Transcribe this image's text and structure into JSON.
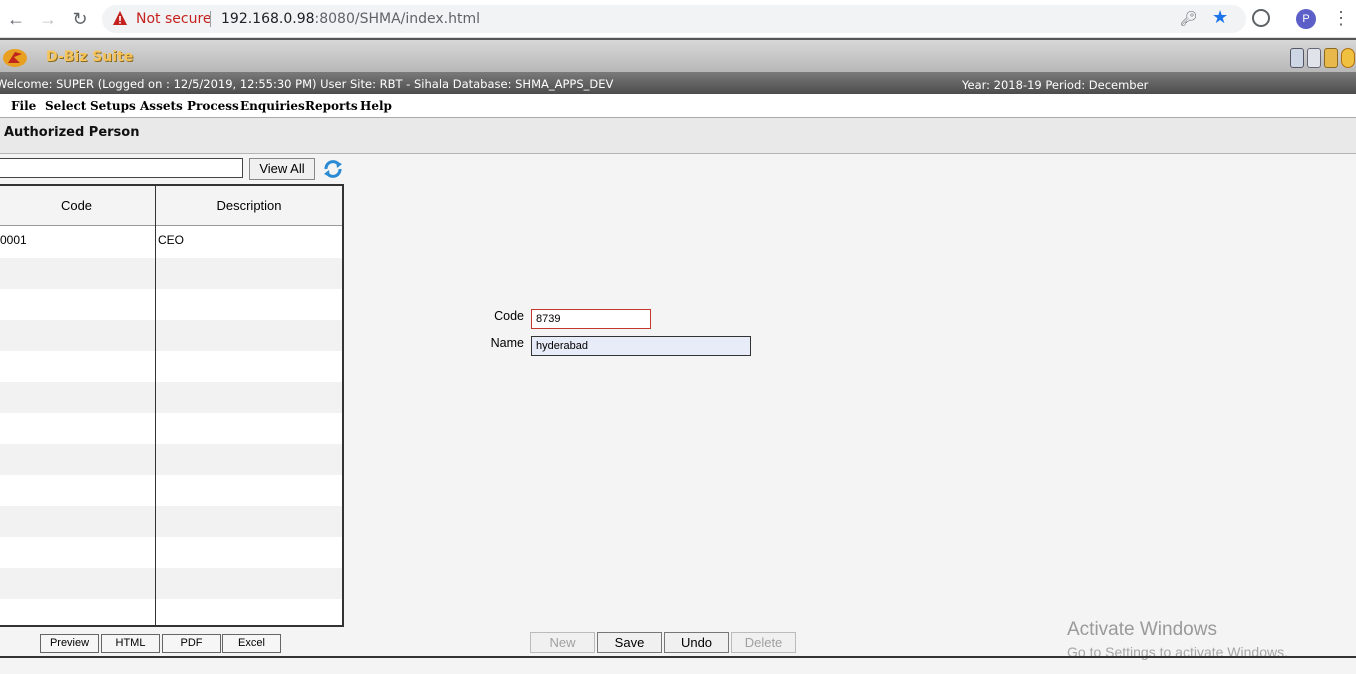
{
  "browser": {
    "security_label": "Not secure",
    "url_host": "192.168.0.98",
    "url_rest": ":8080/SHMA/index.html",
    "profile_initial": "P"
  },
  "app": {
    "title": "D-Biz Suite",
    "status_left": "Welcome: SUPER (Logged on : 12/5/2019, 12:55:30 PM) User Site: RBT - Sihala Database: SHMA_APPS_DEV",
    "status_right": "Year: 2018-19 Period: December"
  },
  "menu": [
    "File",
    "Select",
    "Setups",
    "Assets",
    "Process",
    "Enquiries",
    "Reports",
    "Help"
  ],
  "page": {
    "title": "Authorized Person"
  },
  "list": {
    "search_value": "",
    "view_all_label": "View All",
    "columns": [
      "Code",
      "Description"
    ],
    "rows": [
      {
        "code": "0001",
        "description": "CEO"
      }
    ],
    "export_buttons": [
      "Preview",
      "HTML",
      "PDF",
      "Excel"
    ]
  },
  "form": {
    "code_label": "Code",
    "code_value": "8739",
    "name_label": "Name",
    "name_value": "hyderabad"
  },
  "actions": {
    "new_label": "New",
    "save_label": "Save",
    "undo_label": "Undo",
    "delete_label": "Delete"
  },
  "watermark": {
    "title": "Activate Windows",
    "subtitle": "Go to Settings to activate Windows."
  },
  "colors": {
    "accent_blue": "#1a73e8",
    "warning_red": "#c5221f",
    "header_gold": "#f6c45a"
  }
}
